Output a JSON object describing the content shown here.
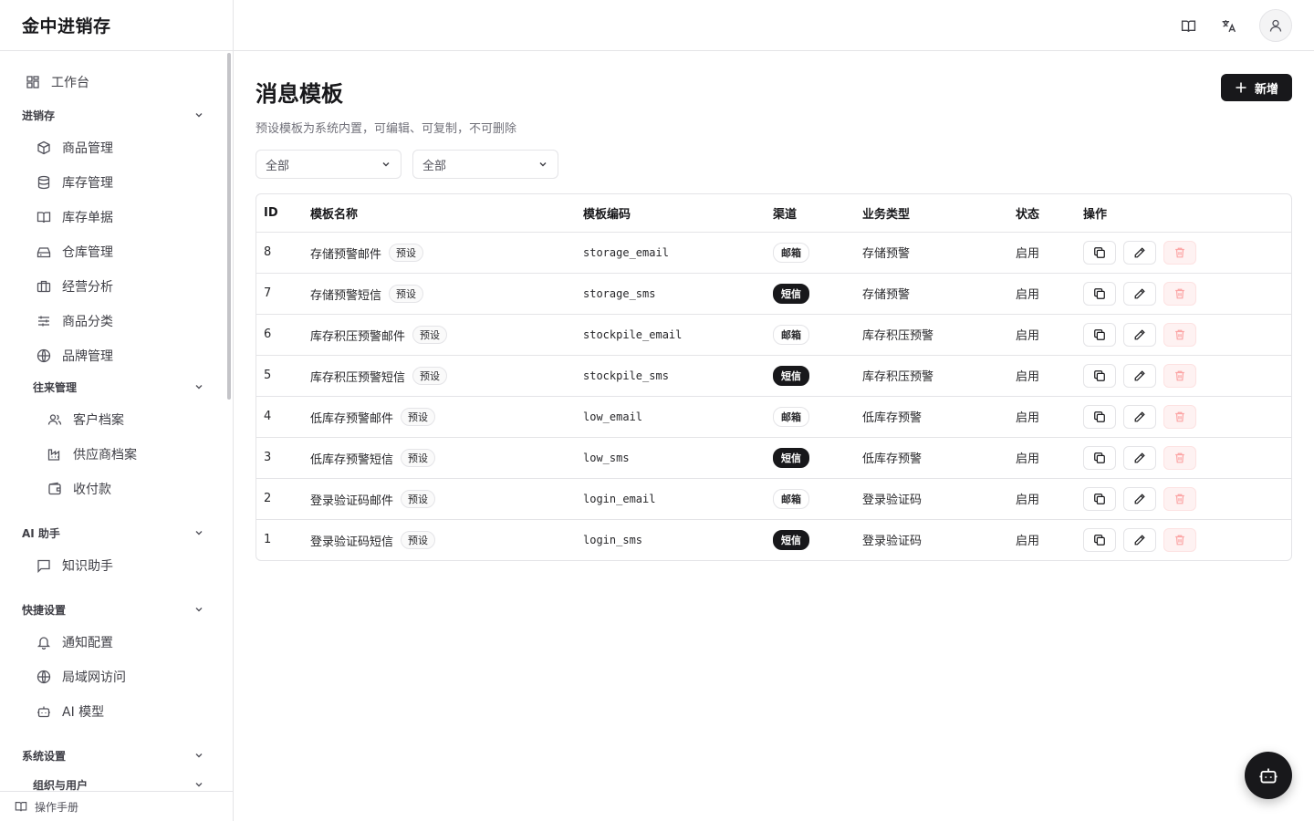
{
  "app": {
    "title": "金中进销存"
  },
  "sidebar": {
    "workbench": "工作台",
    "groups": {
      "jxc": "进销存",
      "wanglai": "往来管理",
      "ai": "AI 助手",
      "quick": "快捷设置",
      "system": "系统设置",
      "org": "组织与用户"
    },
    "items": {
      "goods": "商品管理",
      "stock": "库存管理",
      "stock_docs": "库存单据",
      "warehouse": "仓库管理",
      "analysis": "经营分析",
      "category": "商品分类",
      "brand": "品牌管理",
      "customer": "客户档案",
      "supplier": "供应商档案",
      "payment": "收付款",
      "knowledge": "知识助手",
      "notify": "通知配置",
      "lan": "局域网访问",
      "ai_model": "AI 模型"
    },
    "footer": "操作手册"
  },
  "page": {
    "title": "消息模板",
    "add_label": "新增",
    "subtitle": "预设模板为系统内置，可编辑、可复制，不可删除",
    "filter1": "全部",
    "filter2": "全部"
  },
  "table": {
    "headers": {
      "id": "ID",
      "name": "模板名称",
      "code": "模板编码",
      "channel": "渠道",
      "biz": "业务类型",
      "status": "状态",
      "ops": "操作"
    },
    "rows": [
      {
        "id": "8",
        "name": "存储预警邮件",
        "tag": "预设",
        "code": "storage_email",
        "channel": "邮箱",
        "biz": "存储预警",
        "status": "启用"
      },
      {
        "id": "7",
        "name": "存储预警短信",
        "tag": "预设",
        "code": "storage_sms",
        "channel": "短信",
        "biz": "存储预警",
        "status": "启用"
      },
      {
        "id": "6",
        "name": "库存积压预警邮件",
        "tag": "预设",
        "code": "stockpile_email",
        "channel": "邮箱",
        "biz": "库存积压预警",
        "status": "启用"
      },
      {
        "id": "5",
        "name": "库存积压预警短信",
        "tag": "预设",
        "code": "stockpile_sms",
        "channel": "短信",
        "biz": "库存积压预警",
        "status": "启用"
      },
      {
        "id": "4",
        "name": "低库存预警邮件",
        "tag": "预设",
        "code": "low_email",
        "channel": "邮箱",
        "biz": "低库存预警",
        "status": "启用"
      },
      {
        "id": "3",
        "name": "低库存预警短信",
        "tag": "预设",
        "code": "low_sms",
        "channel": "短信",
        "biz": "低库存预警",
        "status": "启用"
      },
      {
        "id": "2",
        "name": "登录验证码邮件",
        "tag": "预设",
        "code": "login_email",
        "channel": "邮箱",
        "biz": "登录验证码",
        "status": "启用"
      },
      {
        "id": "1",
        "name": "登录验证码短信",
        "tag": "预设",
        "code": "login_sms",
        "channel": "短信",
        "biz": "登录验证码",
        "status": "启用"
      }
    ]
  },
  "icons": {
    "topbar": [
      "book-icon",
      "translate-icon",
      "user-icon"
    ],
    "row_ops": [
      "copy-icon",
      "edit-icon",
      "trash-icon"
    ],
    "fab": "bot-icon"
  }
}
